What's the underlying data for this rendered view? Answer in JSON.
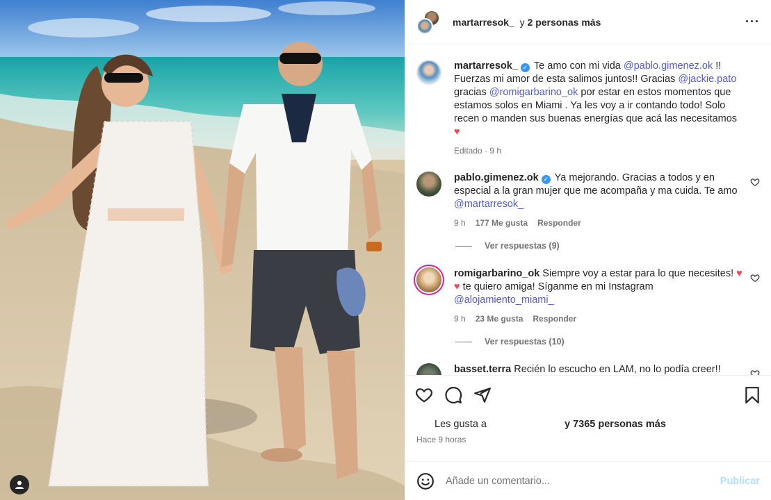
{
  "header": {
    "username": "martarresok_",
    "more_prefix": "y",
    "more_bold": "2 personas más"
  },
  "caption": {
    "username": "martarresok_",
    "text_1": "Te amo con mi vida",
    "mention_1": "@pablo.gimenez.ok",
    "text_2": "!! Fuerzas mi amor de esta salimos juntos!! Gracias",
    "mention_2": "@jackie.pato",
    "text_3": "gracias",
    "mention_3": "@romigarbarino_ok",
    "text_4": "por estar en estos momentos que estamos solos en Miami . Ya les voy a ir contando todo! Solo recen o manden sus buenas energías que acá las necesitamos",
    "emoji": "♥",
    "meta": "Editado · 9 h"
  },
  "comments": [
    {
      "username": "pablo.gimenez.ok",
      "text": "Ya mejorando. Gracias a todos y en especial a la gran mujer que me acompaña y ma cuida. Te amo",
      "mention": "@martarresok_",
      "time": "9 h",
      "likes": "177 Me gusta",
      "reply": "Responder",
      "view_replies": "Ver respuestas (9)"
    },
    {
      "username": "romigarbarino_ok",
      "text_1": "Siempre voy a estar para lo que necesites!",
      "emoji": "♥ ♥",
      "text_2": "te quiero amiga! Síganme en mi Instagram",
      "mention": "@alojamiento_miami_",
      "time": "9 h",
      "likes": "23 Me gusta",
      "reply": "Responder",
      "view_replies": "Ver respuestas (10)"
    },
    {
      "username": "basset.terra",
      "text": "Recién lo escucho en LAM, no lo podía creer!! Mucha buena energía desde Córdoba Mar!! Y para tu novio!!"
    }
  ],
  "likes_line": {
    "prefix": "Les gusta a",
    "suffix": "y 7365 personas más"
  },
  "time_ago": "Hace 9 horas",
  "comment_box": {
    "placeholder": "Añade un comentario...",
    "post_label": "Publicar"
  },
  "verified_mark": "✓"
}
